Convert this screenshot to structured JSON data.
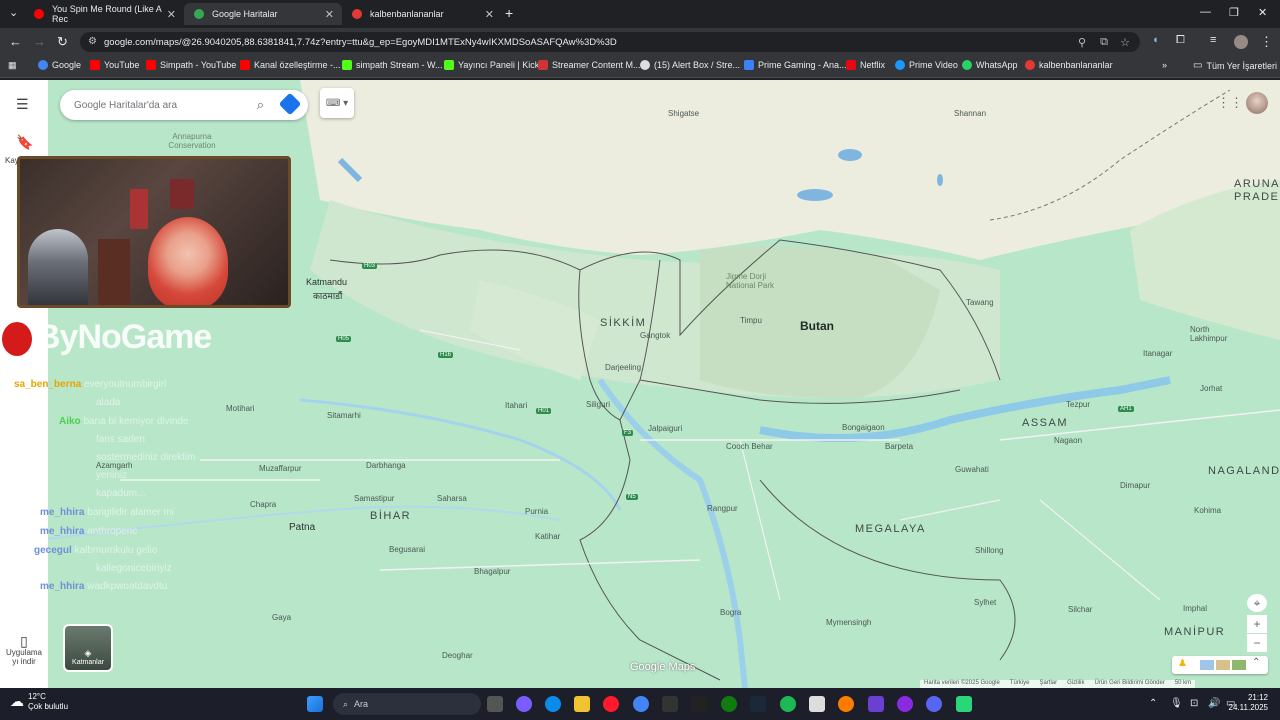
{
  "browser": {
    "tabs": [
      {
        "title": "You Spin Me Round (Like A Rec",
        "color": "#ff0000"
      },
      {
        "title": "Google Haritalar",
        "color": "#34a853"
      },
      {
        "title": "kalbenbanlananlar",
        "color": "#e53935"
      }
    ],
    "url": "google.com/maps/@26.9040205,88.6381841,7.74z?entry=ttu&g_ep=EgoyMDI1MTExNy4wIKXMDSoASAFQAw%3D%3D",
    "bookmarks": [
      "Google",
      "YouTube",
      "Simpath - YouTube",
      "Kanal özelleştirme -...",
      "simpath Stream - W...",
      "Yayıncı Paneli | Kick",
      "Streamer Content M...",
      "(15) Alert Box / Stre...",
      "Prime Gaming - Ana...",
      "Netflix",
      "Prime Video",
      "WhatsApp",
      "kalbenbanlananlar"
    ],
    "all_bookmarks": "Tüm Yer İşaretleri"
  },
  "maps": {
    "search_placeholder": "Google Haritalar'da ara",
    "saved_label": "Kay",
    "layers_label": "Katmanlar",
    "app_label": "Uygulama yı indir",
    "logo": "Google Maps",
    "attribution": [
      "Harita verileri ©2025 Google",
      "Türkiye",
      "Şartlar",
      "Gizlilik",
      "Ürün Geri Bildirimi Gönder",
      "50 km"
    ]
  },
  "map_labels": {
    "countries": [
      "Butan"
    ],
    "regions": [
      "SİKKİM",
      "BİHAR",
      "MEGALAYA",
      "ASSAM",
      "NAGALAND",
      "MANİPUR",
      "ARUNAÇ PRADE"
    ],
    "cities": [
      "Katmandu",
      "काठमाडौं",
      "Patna",
      "Timpu",
      "Gangtok",
      "Darjeeling",
      "Siliguri",
      "Shillong",
      "Guwahati",
      "Mymensingh",
      "Bogra",
      "Sylhet",
      "Imphal",
      "Itanagar",
      "Tawang",
      "Dimapur",
      "Kohima",
      "Jorhat",
      "Tezpur",
      "Nagaon",
      "Cooch Behar",
      "Jalpaiguri",
      "Bongaigaon",
      "Barpeta",
      "Purnia",
      "Katihar",
      "Bhagalpur",
      "Begusarai",
      "Samastipur",
      "Darbhanga",
      "Muzaffarpur",
      "Sitamarhi",
      "Motihari",
      "Azamgarh",
      "Chapra",
      "Gaya",
      "Deoghar",
      "Rangpur",
      "Silchar",
      "Shigatse",
      "Shannan",
      "North Lakhimpur",
      "Itahari",
      "Saharsa"
    ],
    "parks": [
      "Jigme Dorji National Park",
      "Annapurna Conservation"
    ]
  },
  "overlay": {
    "brand": "ByNoGame",
    "chat": [
      {
        "user": "sa_ben_berna",
        "msg": "everyoutnumbirgirl",
        "color": "#e6a400"
      },
      {
        "user": "",
        "msg": "alada",
        "color": "#e6a400"
      },
      {
        "user": "Aiko",
        "msg": "bana bi kemiyor divinde",
        "color": "#4ccf4c"
      },
      {
        "user": "",
        "msg": "fans saden",
        "color": "#4ccf4c"
      },
      {
        "user": "",
        "msg": "sostermediniz direktim",
        "color": "#4ccf4c"
      },
      {
        "user": "",
        "msg": "yeniniz",
        "color": "#4ccf4c"
      },
      {
        "user": "",
        "msg": "kapadum...",
        "color": "#4ccf4c"
      },
      {
        "user": "me_hhira",
        "msg": "bangilidir alamer mi",
        "color": "#6e8fd9"
      },
      {
        "user": "me_hhira",
        "msg": "anthropenc",
        "color": "#6e8fd9"
      },
      {
        "user": "gecegul",
        "msg": "kalbmumkulu gelio",
        "color": "#6e8fd9"
      },
      {
        "user": "",
        "msg": "kallegonicebiriyiz",
        "color": "#6e8fd9"
      },
      {
        "user": "me_hhira",
        "msg": "wadkpwoatdavdtu",
        "color": "#6e8fd9"
      }
    ]
  },
  "taskbar": {
    "temp": "12°C",
    "weather": "Çok bulutlu",
    "search": "Ara",
    "time": "21:12",
    "date": "24.11.2025"
  }
}
